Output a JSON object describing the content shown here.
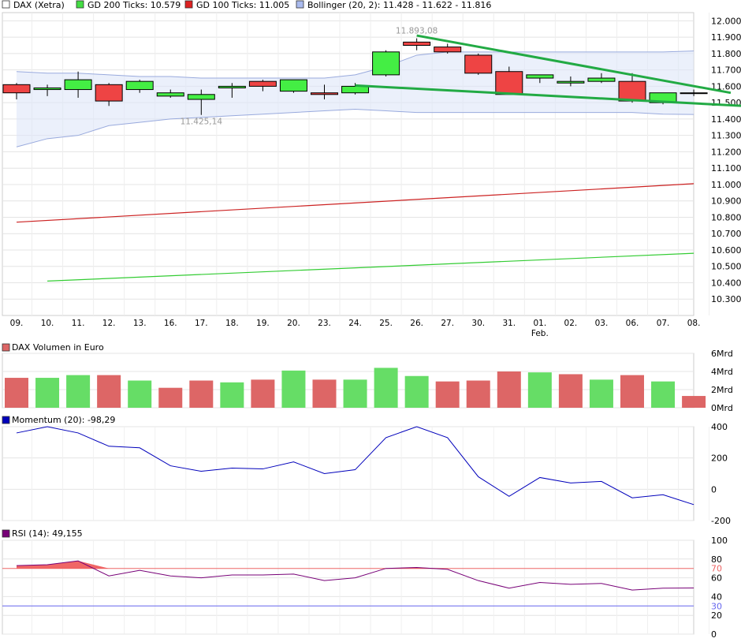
{
  "chart_data": [
    {
      "type": "candlestick",
      "panel": "price",
      "ylim": [
        10200,
        12050
      ],
      "yticks": [
        10300,
        10400,
        10500,
        10600,
        10700,
        10800,
        10900,
        11000,
        11100,
        11200,
        11300,
        11400,
        11500,
        11600,
        11700,
        11800,
        11900,
        12000
      ],
      "ytick_labels": [
        "10.300",
        "10.400",
        "10.500",
        "10.600",
        "10.700",
        "10.800",
        "10.900",
        "11.000",
        "11.100",
        "11.200",
        "11.300",
        "11.400",
        "11.500",
        "11.600",
        "11.700",
        "11.800",
        "11.900",
        "12.000"
      ],
      "categories": [
        "09.",
        "10.",
        "11.",
        "12.",
        "13.",
        "16.",
        "17.",
        "18.",
        "19.",
        "20.",
        "23.",
        "24.",
        "25.",
        "26.",
        "27.",
        "30.",
        "31.",
        "01.",
        "02.",
        "03.",
        "06.",
        "07.",
        "08."
      ],
      "month_label": {
        "text": "Feb.",
        "category_index": 17
      },
      "legend": [
        {
          "label": "DAX (Xetra)",
          "color": "#ffffff"
        },
        {
          "label": "GD 200 Ticks: 10.579",
          "color": "#44dd44"
        },
        {
          "label": "GD 100 Ticks: 11.005",
          "color": "#dd2222"
        },
        {
          "label": "Bollinger (20, 2): 11.428 - 11.622 - 11.816",
          "color": "#aabbee"
        }
      ],
      "candles": [
        {
          "open": 11610,
          "high": 11620,
          "low": 11520,
          "close": 11560
        },
        {
          "open": 11580,
          "high": 11610,
          "low": 11540,
          "close": 11590
        },
        {
          "open": 11580,
          "high": 11690,
          "low": 11530,
          "close": 11640
        },
        {
          "open": 11610,
          "high": 11620,
          "low": 11480,
          "close": 11510
        },
        {
          "open": 11580,
          "high": 11640,
          "low": 11560,
          "close": 11630
        },
        {
          "open": 11540,
          "high": 11580,
          "low": 11530,
          "close": 11560
        },
        {
          "open": 11520,
          "high": 11580,
          "low": 11425,
          "close": 11550
        },
        {
          "open": 11590,
          "high": 11620,
          "low": 11530,
          "close": 11600
        },
        {
          "open": 11630,
          "high": 11640,
          "low": 11570,
          "close": 11600
        },
        {
          "open": 11570,
          "high": 11640,
          "low": 11560,
          "close": 11640
        },
        {
          "open": 11560,
          "high": 11610,
          "low": 11520,
          "close": 11550
        },
        {
          "open": 11560,
          "high": 11620,
          "low": 11550,
          "close": 11600
        },
        {
          "open": 11670,
          "high": 11820,
          "low": 11660,
          "close": 11810
        },
        {
          "open": 11870,
          "high": 11893,
          "low": 11820,
          "close": 11850
        },
        {
          "open": 11840,
          "high": 11860,
          "low": 11800,
          "close": 11810
        },
        {
          "open": 11790,
          "high": 11800,
          "low": 11670,
          "close": 11680
        },
        {
          "open": 11690,
          "high": 11720,
          "low": 11550,
          "close": 11550
        },
        {
          "open": 11650,
          "high": 11670,
          "low": 11620,
          "close": 11670
        },
        {
          "open": 11620,
          "high": 11660,
          "low": 11600,
          "close": 11630
        },
        {
          "open": 11630,
          "high": 11680,
          "low": 11620,
          "close": 11650
        },
        {
          "open": 11630,
          "high": 11680,
          "low": 11500,
          "close": 11510
        },
        {
          "open": 11500,
          "high": 11560,
          "low": 11490,
          "close": 11560
        },
        {
          "open": 11560,
          "high": 11580,
          "low": 11540,
          "close": 11560
        }
      ],
      "gd200": {
        "x": [
          1,
          22
        ],
        "y": [
          10410,
          10580
        ]
      },
      "gd100": {
        "x": [
          0,
          22
        ],
        "y": [
          10770,
          11005
        ]
      },
      "bollinger_upper": [
        11690,
        11680,
        11680,
        11670,
        11660,
        11660,
        11650,
        11650,
        11650,
        11650,
        11650,
        11670,
        11720,
        11790,
        11810,
        11810,
        11810,
        11810,
        11810,
        11810,
        11810,
        11810,
        11816
      ],
      "bollinger_lower": [
        11230,
        11280,
        11300,
        11360,
        11380,
        11400,
        11410,
        11420,
        11430,
        11440,
        11450,
        11460,
        11450,
        11440,
        11440,
        11440,
        11440,
        11440,
        11440,
        11440,
        11440,
        11430,
        11428
      ],
      "trendlines": [
        {
          "x": [
            13,
            23.2
          ],
          "y": [
            11910,
            11560
          ]
        },
        {
          "x": [
            11,
            23.6
          ],
          "y": [
            11605,
            11480
          ]
        }
      ],
      "annotations": [
        {
          "text": "11.893,08",
          "x": 13,
          "y": 11893
        },
        {
          "text": "11.425,14",
          "x": 6,
          "y": 11425
        }
      ]
    },
    {
      "type": "bar",
      "panel": "volume",
      "title": "DAX Volumen in Euro",
      "ylim": [
        0,
        6
      ],
      "yticks": [
        0,
        2,
        4,
        6
      ],
      "ytick_labels": [
        "0Mrd",
        "2Mrd",
        "4Mrd",
        "6Mrd"
      ],
      "values": [
        3.3,
        3.3,
        3.6,
        3.6,
        3.0,
        2.2,
        3.0,
        2.8,
        3.1,
        4.1,
        3.1,
        3.1,
        4.4,
        3.5,
        2.9,
        3.0,
        4.0,
        3.9,
        3.7,
        3.1,
        3.6,
        2.9,
        1.3
      ],
      "colors": [
        "r",
        "g",
        "g",
        "r",
        "g",
        "r",
        "r",
        "g",
        "r",
        "g",
        "r",
        "g",
        "g",
        "g",
        "r",
        "r",
        "r",
        "g",
        "r",
        "g",
        "r",
        "g",
        "r"
      ],
      "up_color": "#66dd66",
      "down_color": "#dd6666"
    },
    {
      "type": "line",
      "panel": "momentum",
      "title": "Momentum (20): -98,29",
      "ylim": [
        -200,
        400
      ],
      "yticks": [
        -200,
        0,
        200,
        400
      ],
      "ytick_labels": [
        "-200",
        "0",
        "200",
        "400"
      ],
      "values": [
        360,
        400,
        360,
        275,
        265,
        150,
        115,
        135,
        130,
        175,
        100,
        125,
        330,
        400,
        330,
        80,
        -45,
        75,
        40,
        50,
        -55,
        -35,
        -98.29
      ],
      "color": "#0000bb"
    },
    {
      "type": "line",
      "panel": "rsi",
      "title": "RSI (14): 49,155",
      "ylim": [
        0,
        100
      ],
      "yticks": [
        0,
        20,
        40,
        60,
        80,
        100
      ],
      "ytick_labels": [
        "0",
        "20",
        "40",
        "60",
        "80",
        "100"
      ],
      "ref_lines": [
        {
          "value": 70,
          "label": "70",
          "color": "#ee6666"
        },
        {
          "value": 30,
          "label": "30",
          "color": "#6666ee"
        }
      ],
      "values": [
        73,
        74,
        78,
        62,
        68,
        62,
        60,
        63,
        63,
        64,
        57,
        60,
        70,
        71,
        69,
        57,
        49,
        55,
        53,
        54,
        47,
        49,
        49.155
      ],
      "color": "#770077",
      "overbought_fill": "#ee5555"
    }
  ]
}
